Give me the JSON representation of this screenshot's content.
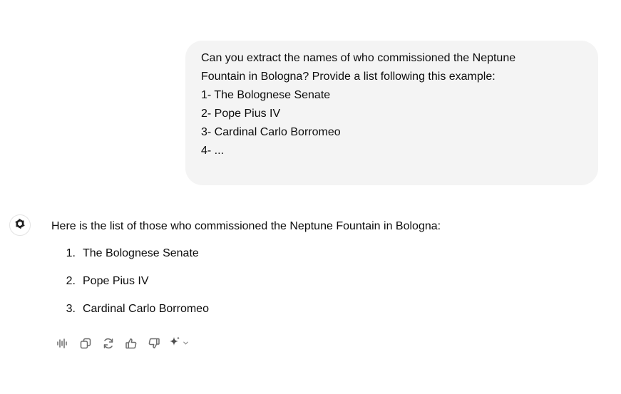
{
  "user_message": {
    "lines": [
      "Can you extract the names of who commissioned the Neptune",
      "Fountain in Bologna? Provide a list following this example:",
      "1- The Bolognese Senate",
      "2- Pope Pius IV",
      "3- Cardinal Carlo Borromeo",
      "4- ..."
    ]
  },
  "assistant_message": {
    "avatar_icon": "openai-logo-icon",
    "intro": "Here is the list of those who commissioned the Neptune Fountain in Bologna:",
    "items": [
      {
        "num": "1.",
        "text": "The Bolognese Senate"
      },
      {
        "num": "2.",
        "text": "Pope Pius IV"
      },
      {
        "num": "3.",
        "text": "Cardinal Carlo Borromeo"
      }
    ]
  },
  "actions": [
    {
      "name": "read-aloud-icon"
    },
    {
      "name": "copy-icon"
    },
    {
      "name": "regenerate-icon"
    },
    {
      "name": "thumbs-up-icon"
    },
    {
      "name": "thumbs-down-icon"
    },
    {
      "name": "sparkle-icon"
    }
  ],
  "colors": {
    "bubble_bg": "#f4f4f4",
    "text": "#0d0d0d",
    "icon": "#6b6b6b"
  }
}
